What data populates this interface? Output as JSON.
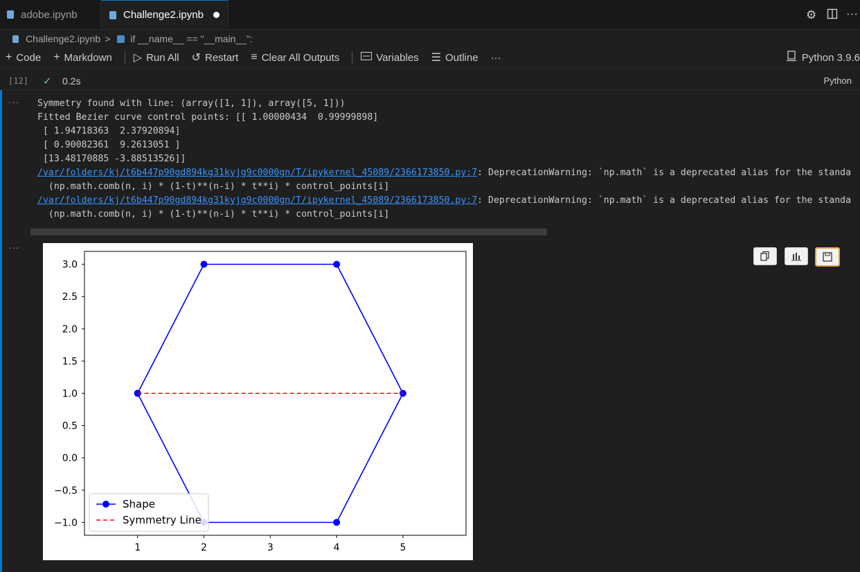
{
  "tabs": [
    {
      "label": "adobe.ipynb",
      "active": false
    },
    {
      "label": "Challenge2.ipynb",
      "active": true,
      "modified": true
    }
  ],
  "breadcrumb": {
    "file": "Challenge2.ipynb",
    "separator": ">",
    "symbol": "if __name__ == \"__main__\":"
  },
  "toolbar": {
    "code": "Code",
    "markdown": "Markdown",
    "run_all": "Run All",
    "restart": "Restart",
    "clear_all_outputs": "Clear All Outputs",
    "variables": "Variables",
    "outline": "Outline",
    "more": "···",
    "kernel": "Python 3.9.6"
  },
  "cell": {
    "exec_count": "[12]",
    "duration": "0.2s",
    "language": "Python",
    "output_ellipsis": "···"
  },
  "output_lines": [
    {
      "text": "Symmetry found with line: (array([1, 1]), array([5, 1]))"
    },
    {
      "text": "Fitted Bezier curve control points: [[ 1.00000434  0.99999898]"
    },
    {
      "text": " [ 1.94718363  2.37920894]"
    },
    {
      "text": " [ 0.90082361  9.2613051 ]"
    },
    {
      "text": " [13.48170885 -3.88513526]]"
    },
    {
      "link": "/var/folders/kj/t6b447p90gd894kg31kyjg9c0000gn/T/ipykernel_45089/2366173850.py:7",
      "text": ": DeprecationWarning: `np.math` is a deprecated alias for the standa"
    },
    {
      "text": "  (np.math.comb(n, i) * (1-t)**(n-i) * t**i) * control_points[i]"
    },
    {
      "link": "/var/folders/kj/t6b447p90gd894kg31kyjg9c0000gn/T/ipykernel_45089/2366173850.py:7",
      "text": ": DeprecationWarning: `np.math` is a deprecated alias for the standa"
    },
    {
      "text": "  (np.math.comb(n, i) * (1-t)**(n-i) * t**i) * control_points[i]"
    }
  ],
  "colors": {
    "accent": "#0078d4",
    "shape_line": "#0000ff",
    "symmetry_line": "#ff0000",
    "link": "#3794ff",
    "success": "#73c991"
  },
  "icons": [
    "settings-gear-icon",
    "split-editor-icon",
    "more-icon",
    "copy-icon",
    "chart-icon",
    "save-icon"
  ],
  "chart_data": {
    "type": "line",
    "series": [
      {
        "name": "Shape",
        "style": "solid-with-markers",
        "color": "#0000ff",
        "x": [
          1,
          2,
          4,
          5,
          4,
          2,
          1
        ],
        "y": [
          1.0,
          3.0,
          3.0,
          1.0,
          -1.0,
          -1.0,
          1.0
        ]
      },
      {
        "name": "Symmetry Line",
        "style": "dashed",
        "color": "#ff0000",
        "x": [
          1,
          5
        ],
        "y": [
          1.0,
          1.0
        ]
      }
    ],
    "xticks": [
      1,
      2,
      3,
      4,
      5
    ],
    "yticks": [
      -1.0,
      -0.5,
      0.0,
      0.5,
      1.0,
      1.5,
      2.0,
      2.5,
      3.0
    ],
    "xtick_labels": [
      "1",
      "2",
      "3",
      "4",
      "5"
    ],
    "ytick_labels": [
      "−1.0",
      "−0.5",
      "0.0",
      "0.5",
      "1.0",
      "1.5",
      "2.0",
      "2.5",
      "3.0"
    ],
    "xlim": [
      0.2,
      5.95
    ],
    "ylim": [
      -1.2,
      3.2
    ],
    "title": "",
    "xlabel": "",
    "ylabel": "",
    "legend": "lower-left",
    "grid": false
  }
}
